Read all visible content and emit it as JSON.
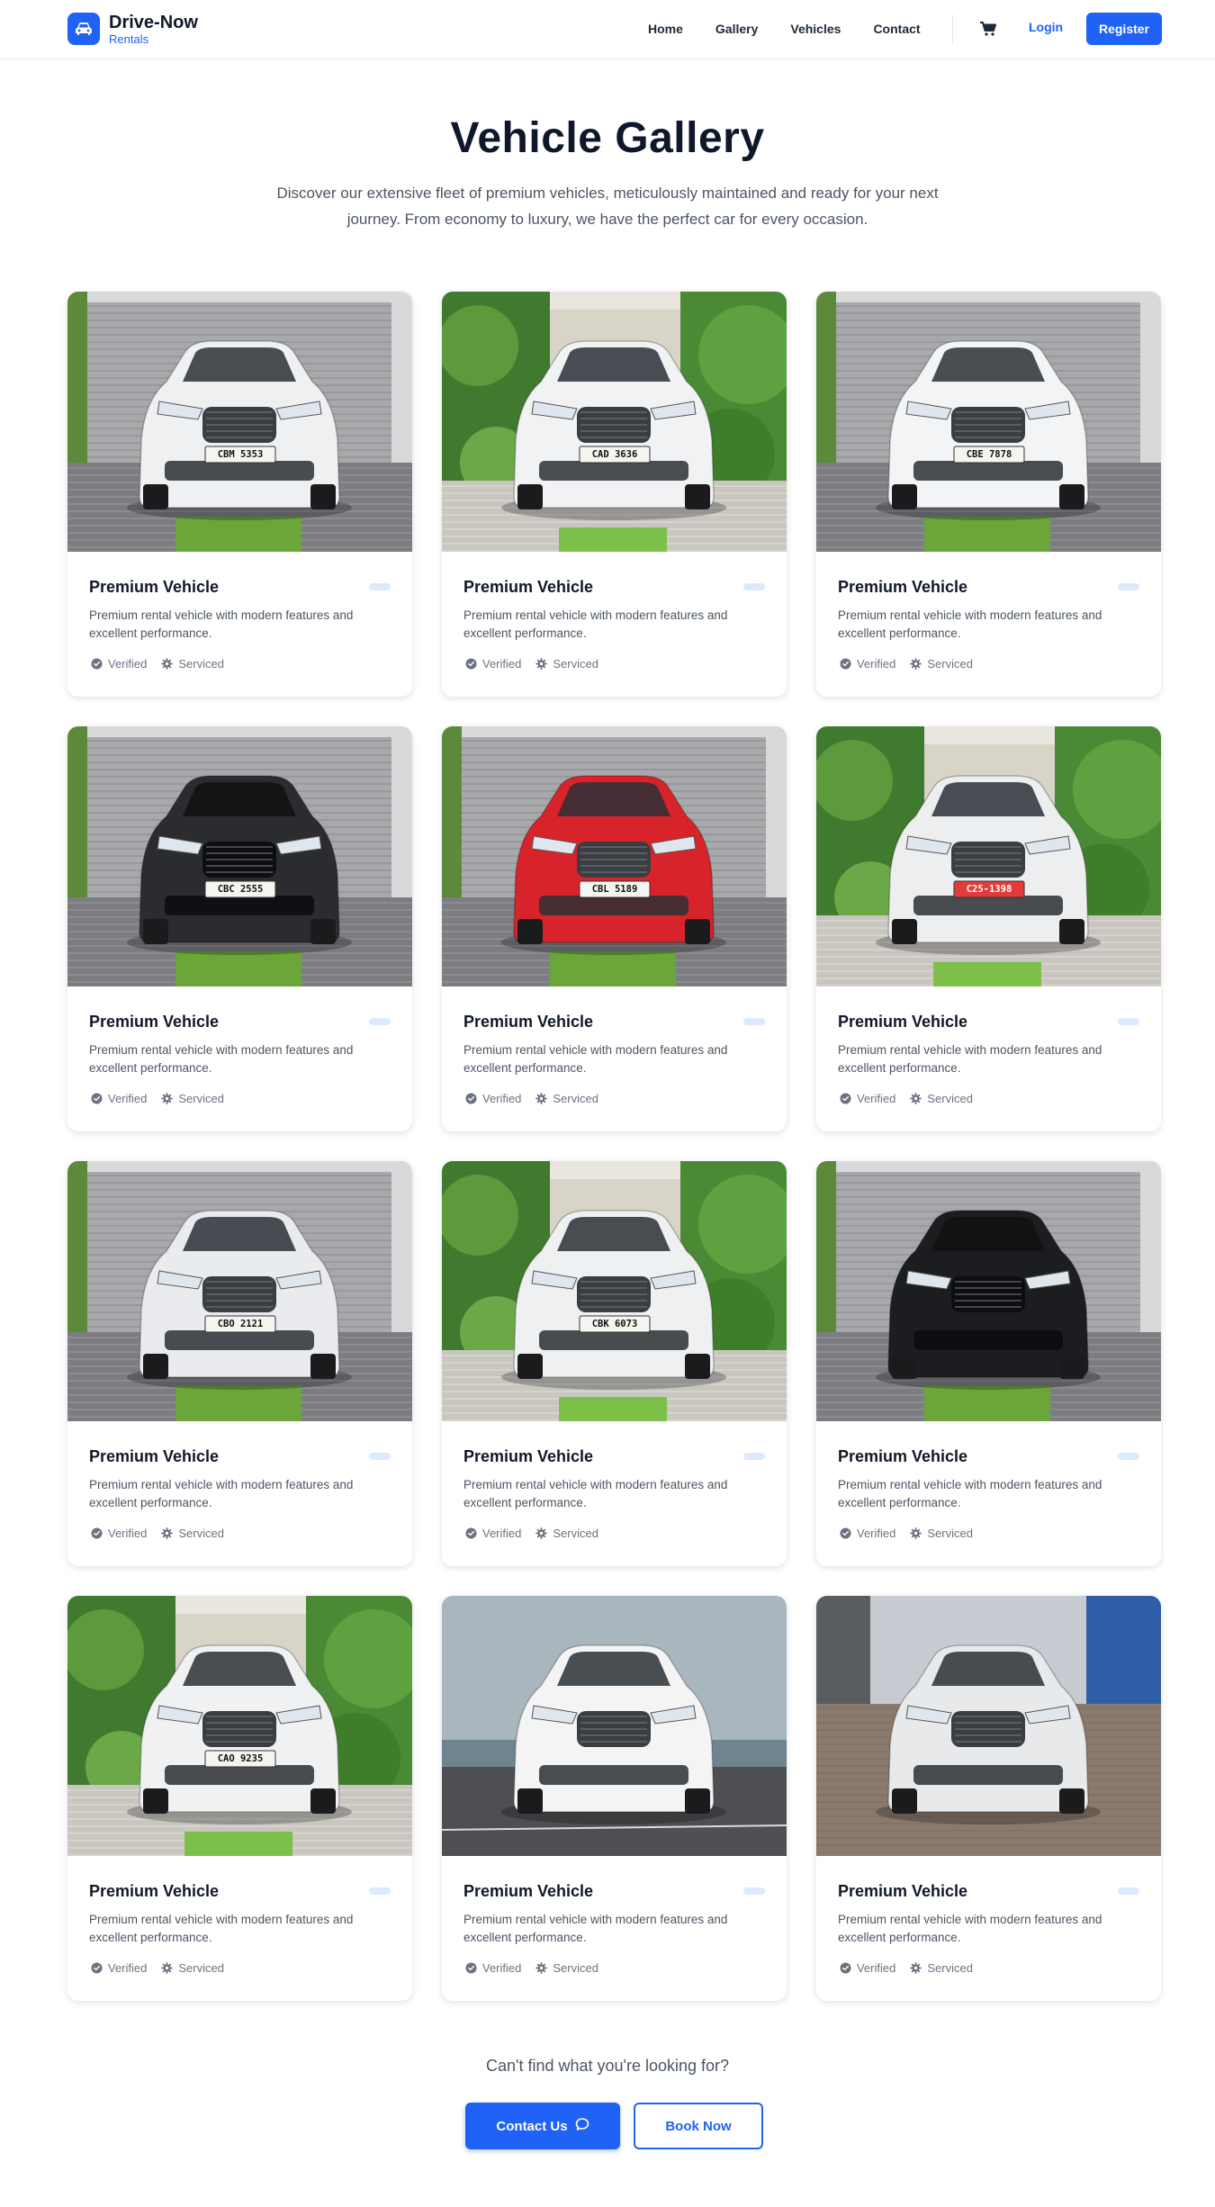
{
  "header": {
    "brand_name": "Drive-Now",
    "brand_sub": "Rentals",
    "brand_icon": "car-icon",
    "nav": [
      "Home",
      "Gallery",
      "Vehicles",
      "Contact"
    ],
    "cart_icon": "cart-icon",
    "login_label": "Login",
    "register_label": "Register"
  },
  "hero": {
    "title": "Vehicle Gallery",
    "description": "Discover our extensive fleet of premium vehicles, meticulously maintained and ready for your next journey. From economy to luxury, we have the perfect car for every occasion."
  },
  "vehicles": [
    {
      "title": "Premium Vehicle",
      "desc": "Premium rental vehicle with modern features and excellent performance.",
      "badge1": "Verified",
      "badge2": "Serviced",
      "plate": "CBM 5353",
      "color": "#eef0f2",
      "bg": "garage"
    },
    {
      "title": "Premium Vehicle",
      "desc": "Premium rental vehicle with modern features and excellent performance.",
      "badge1": "Verified",
      "badge2": "Serviced",
      "plate": "CAD 3636",
      "color": "#f1f2f3",
      "bg": "garden"
    },
    {
      "title": "Premium Vehicle",
      "desc": "Premium rental vehicle with modern features and excellent performance.",
      "badge1": "Verified",
      "badge2": "Serviced",
      "plate": "CBE 7878",
      "color": "#f3f4f5",
      "bg": "garage"
    },
    {
      "title": "Premium Vehicle",
      "desc": "Premium rental vehicle with modern features and excellent performance.",
      "badge1": "Verified",
      "badge2": "Serviced",
      "plate": "CBC 2555",
      "color": "#2a2c30",
      "bg": "garage"
    },
    {
      "title": "Premium Vehicle",
      "desc": "Premium rental vehicle with modern features and excellent performance.",
      "badge1": "Verified",
      "badge2": "Serviced",
      "plate": "CBL 5189",
      "color": "#d8232a",
      "bg": "garage"
    },
    {
      "title": "Premium Vehicle",
      "desc": "Premium rental vehicle with modern features and excellent performance.",
      "badge1": "Verified",
      "badge2": "Serviced",
      "plate": "C25-1398",
      "color": "#eceef0",
      "bg": "garden"
    },
    {
      "title": "Premium Vehicle",
      "desc": "Premium rental vehicle with modern features and excellent performance.",
      "badge1": "Verified",
      "badge2": "Serviced",
      "plate": "CBO 2121",
      "color": "#e9ebee",
      "bg": "garage"
    },
    {
      "title": "Premium Vehicle",
      "desc": "Premium rental vehicle with modern features and excellent performance.",
      "badge1": "Verified",
      "badge2": "Serviced",
      "plate": "CBK 6073",
      "color": "#eef0f2",
      "bg": "garden"
    },
    {
      "title": "Premium Vehicle",
      "desc": "Premium rental vehicle with modern features and excellent performance.",
      "badge1": "Verified",
      "badge2": "Serviced",
      "plate": "",
      "color": "#1c1d20",
      "bg": "garage"
    },
    {
      "title": "Premium Vehicle",
      "desc": "Premium rental vehicle with modern features and excellent performance.",
      "badge1": "Verified",
      "badge2": "Serviced",
      "plate": "CAO 9235",
      "color": "#f0f1f2",
      "bg": "garden"
    },
    {
      "title": "Premium Vehicle",
      "desc": "Premium rental vehicle with modern features and excellent performance.",
      "badge1": "Verified",
      "badge2": "Serviced",
      "plate": "",
      "color": "#f4f4f5",
      "bg": "road"
    },
    {
      "title": "Premium Vehicle",
      "desc": "Premium rental vehicle with modern features and excellent performance.",
      "badge1": "Verified",
      "badge2": "Serviced",
      "plate": "",
      "color": "#e7e9eb",
      "bg": "paving"
    }
  ],
  "cta": {
    "text": "Can't find what you're looking for?",
    "contact_label": "Contact Us",
    "book_label": "Book Now"
  }
}
